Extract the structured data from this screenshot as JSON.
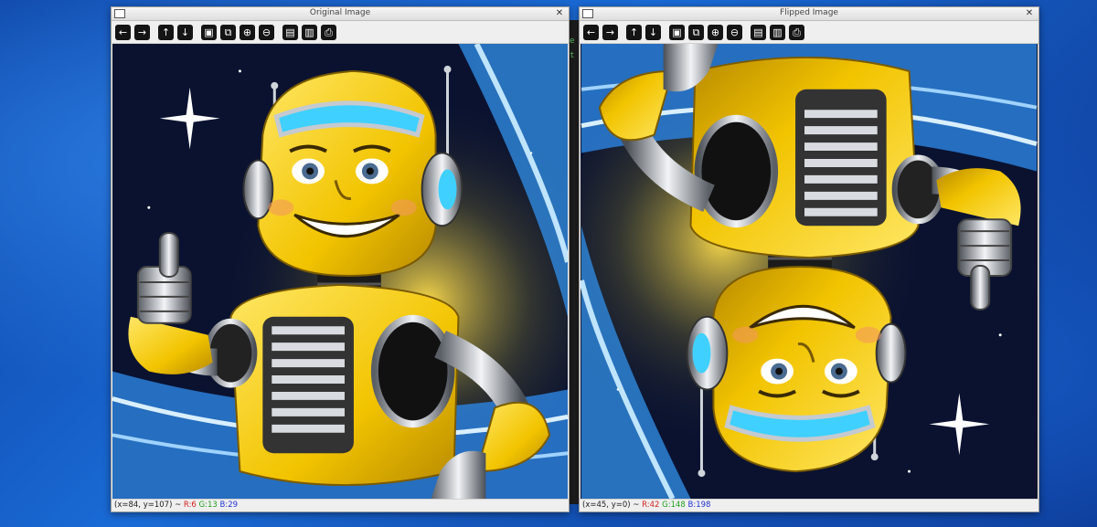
{
  "windows": [
    {
      "title": "Original Image",
      "status": {
        "coords": "(x=84, y=107) ~",
        "r": "R:6",
        "g": "G:13",
        "b": "B:29"
      }
    },
    {
      "title": "Flipped Image",
      "status": {
        "coords": "(x=45, y=0) ~",
        "r": "R:42",
        "g": "G:148",
        "b": "B:198"
      }
    }
  ],
  "toolbar_icons": [
    "arrow-left-icon",
    "arrow-right-icon",
    "arrow-up-icon",
    "arrow-down-icon",
    "zoom-fit-icon",
    "zoom-window-icon",
    "zoom-in-icon",
    "zoom-out-icon",
    "save-icon",
    "properties-icon",
    "print-icon"
  ],
  "toolbar_glyphs": [
    "←",
    "→",
    "↑",
    "↓",
    "▣",
    "⧉",
    "⊕",
    "⊖",
    "▤",
    "▥",
    "⎙"
  ],
  "colors": {
    "robot_yellow": "#f2c400",
    "space_dark": "#0a1230",
    "swirl_blue": "#2f8ae0",
    "visor_cyan": "#3fd0ff"
  }
}
